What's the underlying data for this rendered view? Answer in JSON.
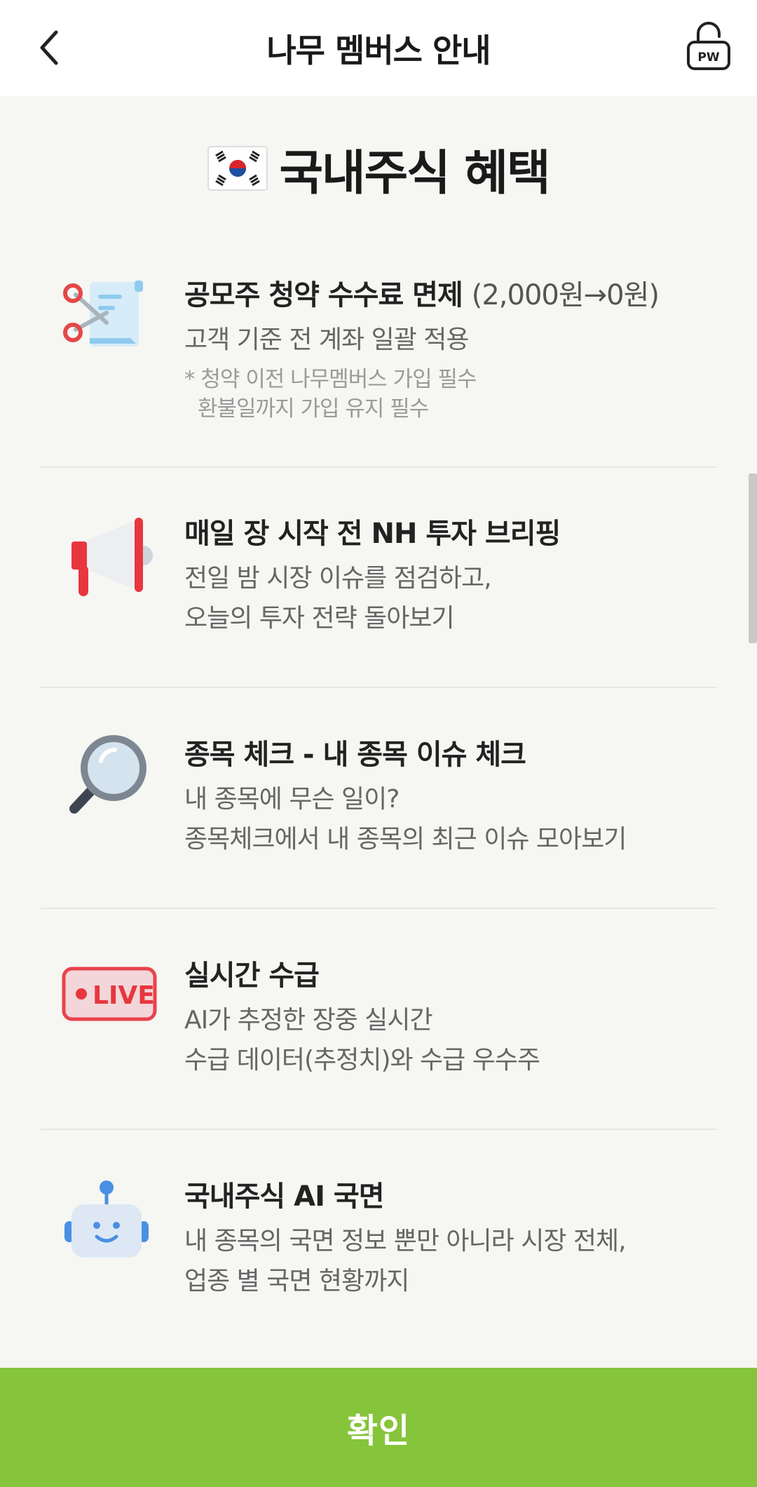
{
  "header": {
    "title": "나무 멤버스 안내",
    "pw_label": "PW"
  },
  "section": {
    "title": "국내주식 혜택"
  },
  "benefits": [
    {
      "title": "공모주 청약 수수료 면제",
      "title_suffix": "(2,000원→0원)",
      "desc": [
        "고객 기준 전 계좌 일괄 적용"
      ],
      "notes": [
        "* 청약 이전 나무멤버스 가입 필수",
        "환불일까지 가입 유지 필수"
      ],
      "icon": "scissors-scroll-icon"
    },
    {
      "title": "매일 장 시작 전 NH 투자 브리핑",
      "desc": [
        "전일 밤 시장 이슈를 점검하고,",
        "오늘의 투자 전략 돌아보기"
      ],
      "icon": "megaphone-icon"
    },
    {
      "title": "종목 체크 - 내 종목 이슈 체크",
      "desc": [
        "내 종목에 무슨 일이?",
        "종목체크에서 내 종목의 최근 이슈 모아보기"
      ],
      "icon": "magnifier-icon"
    },
    {
      "title": "실시간 수급",
      "desc": [
        "AI가 추정한 장중 실시간",
        "수급 데이터(추정치)와 수급 우수주"
      ],
      "icon": "live-badge-icon",
      "icon_text": "LIVE"
    },
    {
      "title": "국내주식 AI 국면",
      "desc": [
        "내 종목의 국면 정보 뿐만 아니라 시장 전체,",
        "업종 별 국면 현황까지"
      ],
      "icon": "robot-icon"
    }
  ],
  "footer": {
    "confirm_label": "확인"
  },
  "colors": {
    "accent": "#86c43c",
    "background": "#f6f6f3",
    "header_bg": "#ffffff"
  }
}
